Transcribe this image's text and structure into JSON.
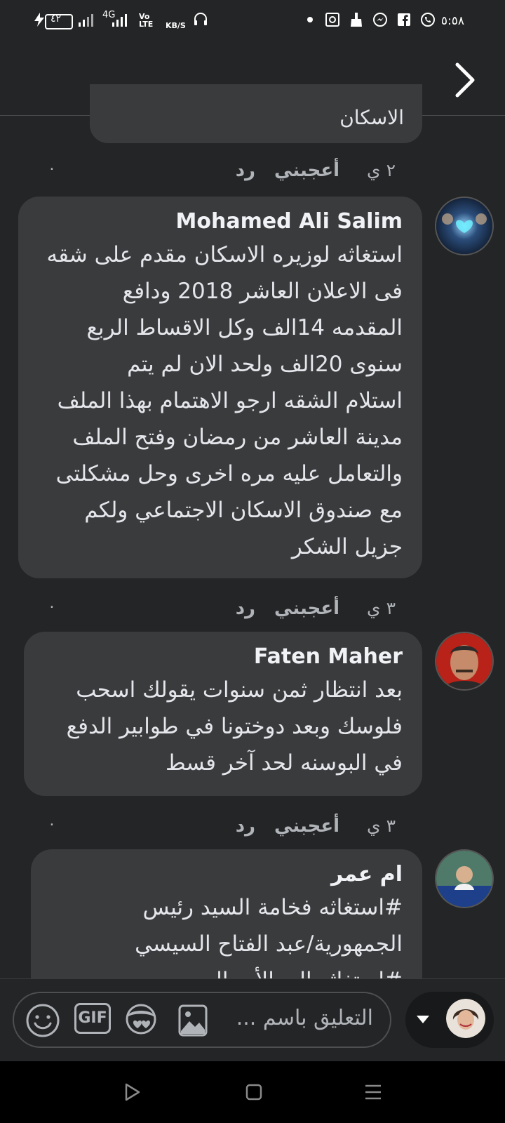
{
  "status_bar": {
    "time": "٥:٥٨",
    "battery": "٤٢",
    "network": "4G",
    "volte": "Vo LTE",
    "speed_unit": "KB/S"
  },
  "previous_comment_tail": "الاسكان",
  "comments": [
    {
      "time": "٢ ي",
      "like_label": "أعجبني",
      "reply_label": "رد",
      "count": "٠"
    },
    {
      "name": "Mohamed Ali Salim",
      "text": "استغاثه لوزيره الاسكان مقدم على شقه\nفى الاعلان العاشر 2018 ودافع\nالمقدمه   14الف وكل الاقساط الربع\nسنوى  20الف   ولحد الان لم يتم\nاستلام الشقه ارجو الاهتمام بهذا الملف\nمدينة العاشر من رمضان وفتح الملف\nوالتعامل عليه مره اخرى وحل مشكلتى\nمع صندوق الاسكان الاجتماعي ولكم\nجزيل الشكر",
      "time": "٣ ي",
      "like_label": "أعجبني",
      "reply_label": "رد",
      "count": "٠"
    },
    {
      "name": "Faten Maher",
      "text": "بعد انتظار ثمن سنوات يقولك اسحب\nفلوسك وبعد دوختونا في طوابير الدفع\nفي البوسنه لحد آخر قسط",
      "time": "٣ ي",
      "like_label": "أعجبني",
      "reply_label": "رد",
      "count": "٠"
    },
    {
      "name": "ام عمر",
      "text": "#استغاثه فخامة السيد رئيس\nالجمهورية/عبد الفتاح السيسي\n#استغاثه الى الأب الروحي"
    }
  ],
  "composer": {
    "placeholder": "التعليق باسم ...",
    "gif_label": "GIF"
  },
  "colors": {
    "background": "#242526",
    "bubble": "#3a3b3c",
    "text": "#e4e6eb",
    "muted": "#b0b3b8"
  }
}
